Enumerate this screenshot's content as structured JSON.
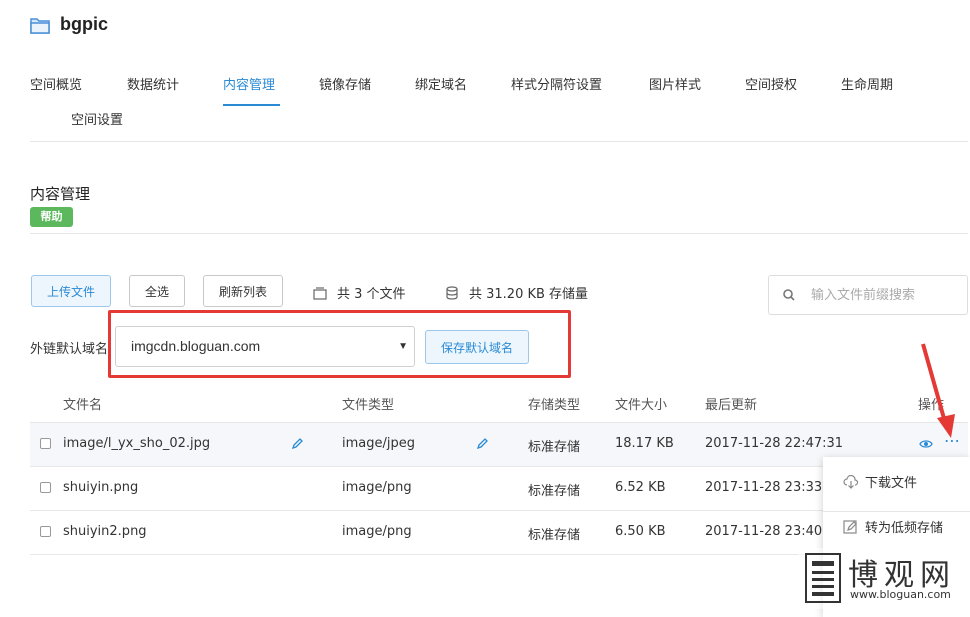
{
  "bucket": {
    "name": "bgpic"
  },
  "tabs": [
    {
      "label": "空间概览"
    },
    {
      "label": "数据统计"
    },
    {
      "label": "内容管理"
    },
    {
      "label": "镜像存储"
    },
    {
      "label": "绑定域名"
    },
    {
      "label": "样式分隔符设置"
    },
    {
      "label": "图片样式"
    },
    {
      "label": "空间授权"
    },
    {
      "label": "生命周期"
    },
    {
      "label": "空间设置"
    }
  ],
  "page": {
    "title": "内容管理",
    "help_label": "帮助"
  },
  "toolbar": {
    "upload_label": "上传文件",
    "select_all_label": "全选",
    "refresh_label": "刷新列表",
    "file_count": "共 3 个文件",
    "storage_total": "共 31.20 KB 存储量",
    "search_placeholder": "输入文件前缀搜索"
  },
  "domain": {
    "label": "外链默认域名",
    "selected": "imgcdn.bloguan.com",
    "save_label": "保存默认域名"
  },
  "table": {
    "headers": [
      "文件名",
      "文件类型",
      "存储类型",
      "文件大小",
      "最后更新",
      "操作"
    ],
    "rows": [
      {
        "name": "image/l_yx_sho_02.jpg",
        "type": "image/jpeg",
        "storage": "标准存储",
        "size": "18.17 KB",
        "updated": "2017-11-28 22:47:31"
      },
      {
        "name": "shuiyin.png",
        "type": "image/png",
        "storage": "标准存储",
        "size": "6.52 KB",
        "updated": "2017-11-28 23:33"
      },
      {
        "name": "shuiyin2.png",
        "type": "image/png",
        "storage": "标准存储",
        "size": "6.50 KB",
        "updated": "2017-11-28 23:40"
      }
    ]
  },
  "dropdown_menu": {
    "items": [
      {
        "label": "下载文件",
        "icon": "cloud-download-icon"
      },
      {
        "label": "转为低频存储",
        "icon": "edit-icon"
      }
    ]
  },
  "watermark": {
    "text": "博观网",
    "url": "www.bloguan.com"
  },
  "colors": {
    "accent": "#2a8ad4",
    "help_green": "#5cb85c",
    "highlight_red": "#e53935"
  }
}
